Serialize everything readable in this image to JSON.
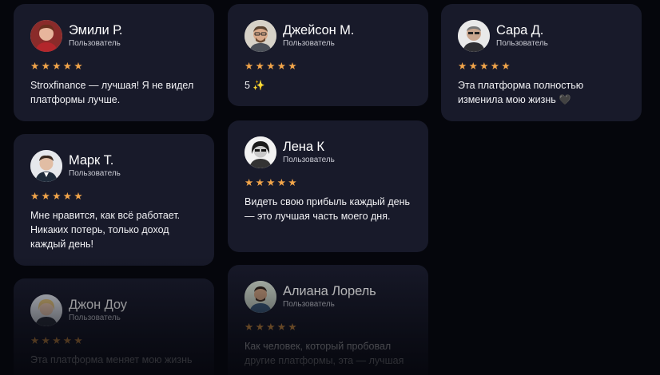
{
  "reviews": [
    {
      "name": "Эмили Р.",
      "role": "Пользователь",
      "stars": 5,
      "text": "Stroxfinance — лучшая! Я не видел платформы лучше."
    },
    {
      "name": "Джейсон М.",
      "role": "Пользователь",
      "stars": 5,
      "text": "5 ✨"
    },
    {
      "name": "Сара Д.",
      "role": "Пользователь",
      "stars": 5,
      "text": "Эта платформа полностью изменила мою жизнь 🖤"
    },
    {
      "name": "Марк Т.",
      "role": "Пользователь",
      "stars": 5,
      "text": "Мне нравится, как всё работает. Никаких потерь, только доход каждый день!"
    },
    {
      "name": "Лена К",
      "role": "Пользователь",
      "stars": 5,
      "text": "Видеть свою прибыль каждый день — это лучшая часть моего дня."
    },
    {
      "name": "Джон Доу",
      "role": "Пользователь",
      "stars": 5,
      "text": "Эта платформа меняет мою жизнь"
    },
    {
      "name": "Алиана Лорель",
      "role": "Пользователь",
      "stars": 5,
      "text": "Как человек, который пробовал другие платформы, эта — лучшая"
    }
  ],
  "colors": {
    "background": "#05060c",
    "card": "#181a2a",
    "star": "#f2a54a"
  },
  "icons": {
    "star": "star-icon"
  }
}
